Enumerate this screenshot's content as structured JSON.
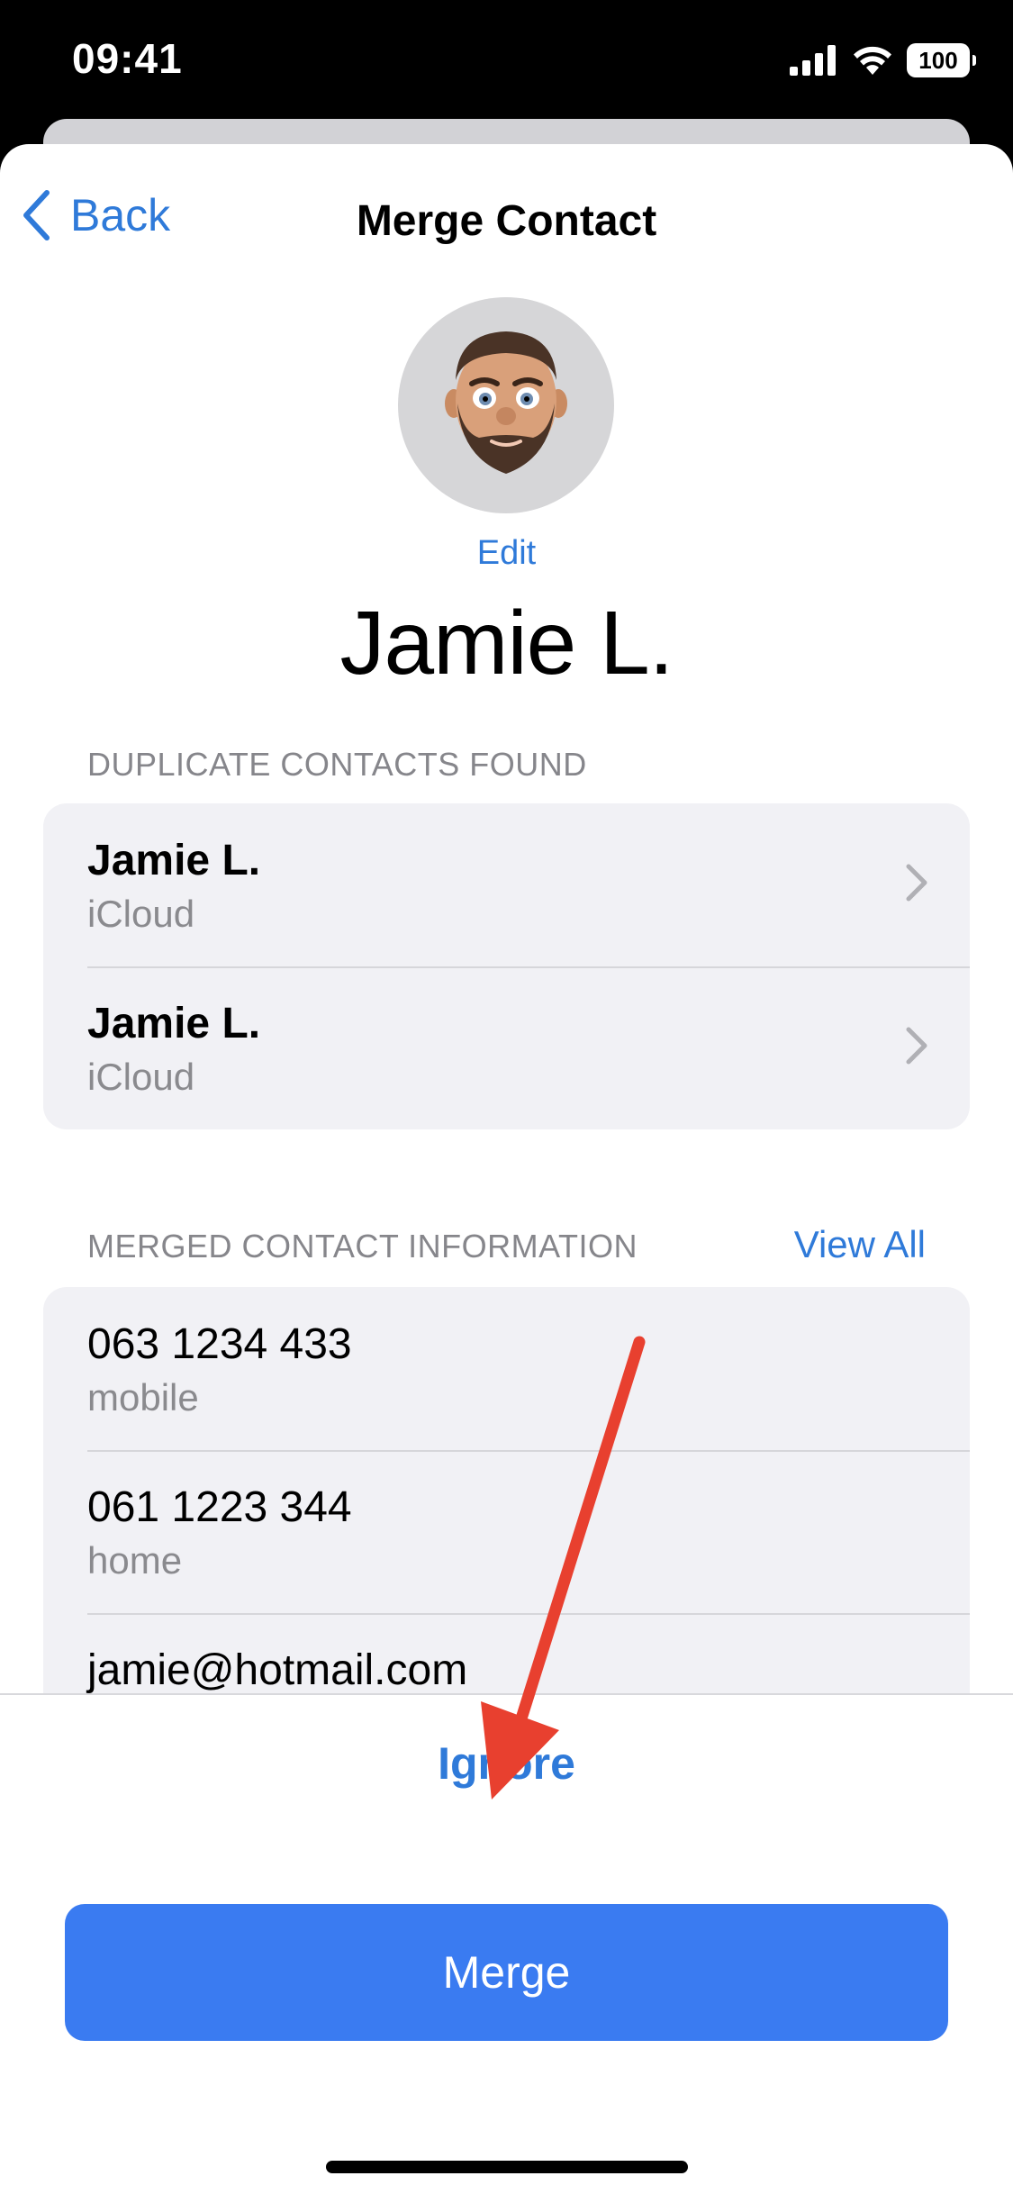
{
  "status_bar": {
    "time": "09:41",
    "battery": "100",
    "icons": [
      "signal-icon",
      "wifi-icon",
      "battery-icon"
    ]
  },
  "nav": {
    "back_label": "Back",
    "title": "Merge Contact"
  },
  "contact": {
    "edit_label": "Edit",
    "name": "Jamie L."
  },
  "duplicates": {
    "header": "DUPLICATE CONTACTS FOUND",
    "items": [
      {
        "name": "Jamie L.",
        "source": "iCloud"
      },
      {
        "name": "Jamie L.",
        "source": "iCloud"
      }
    ]
  },
  "merged": {
    "header": "MERGED CONTACT INFORMATION",
    "view_all_label": "View All",
    "items": [
      {
        "value": "063 1234 433",
        "label": "mobile"
      },
      {
        "value": "061 1223 344",
        "label": "home"
      },
      {
        "value": "jamie@hotmail.com",
        "label": ""
      }
    ]
  },
  "actions": {
    "merge_label": "Merge",
    "ignore_label": "Ignore"
  },
  "colors": {
    "accent": "#2f7ad9",
    "merge_button": "#3a7bf1",
    "annotation_arrow": "#e8402f"
  }
}
